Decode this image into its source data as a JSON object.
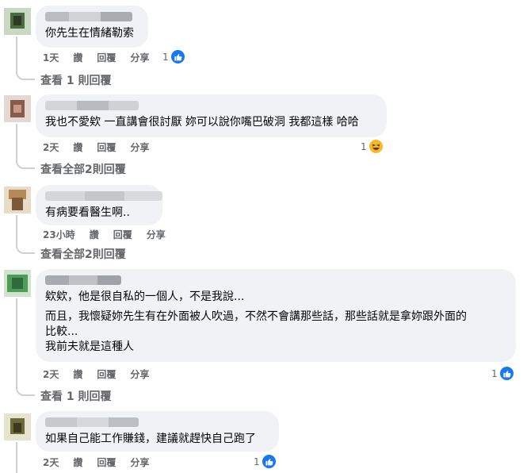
{
  "comments": [
    {
      "text_lines": [
        "你先生在情緒勒索"
      ],
      "time": "1天",
      "like_label": "讚",
      "reply_label": "回覆",
      "share_label": "分享",
      "reaction_count": "1",
      "reaction_type": "like-icon",
      "replies_link": "查看 1 則回覆"
    },
    {
      "text_lines": [
        "我也不愛欸 一直講會很討厭 妳可以說你嘴巴破洞 我都這樣 哈哈"
      ],
      "time": "2天",
      "like_label": "讚",
      "reply_label": "回覆",
      "share_label": "分享",
      "reaction_count": "1",
      "reaction_type": "haha-icon",
      "replies_link": "查看全部2則回覆"
    },
    {
      "text_lines": [
        "有病要看醫生啊.."
      ],
      "time": "23小時",
      "like_label": "讚",
      "reply_label": "回覆",
      "share_label": "分享",
      "reaction_count": "",
      "reaction_type": "",
      "replies_link": "查看全部2則回覆"
    },
    {
      "text_lines": [
        "欸欸，他是很自私的一個人，不是我說...",
        "而且，我懷疑妳先生有在外面被人吹過，不然不會講那些話，那些話就是拿妳跟外面的",
        "比較...",
        "我前夫就是這種人"
      ],
      "time": "2天",
      "like_label": "讚",
      "reply_label": "回覆",
      "share_label": "分享",
      "reaction_count": "1",
      "reaction_type": "like-icon",
      "replies_link": "查看 1 則回覆"
    },
    {
      "text_lines": [
        "如果自己能工作賺錢，建議就趕快自己跑了"
      ],
      "time": "2天",
      "like_label": "讚",
      "reply_label": "回覆",
      "share_label": "分享",
      "reaction_count": "1",
      "reaction_type": "like-icon",
      "replies_link": ""
    }
  ],
  "colors": {
    "bubble": "#f0f2f5",
    "meta_text": "#65676b",
    "like_blue": "#1877f2",
    "haha_yellow": "#f7b928",
    "thread_line": "#ced0d4"
  }
}
